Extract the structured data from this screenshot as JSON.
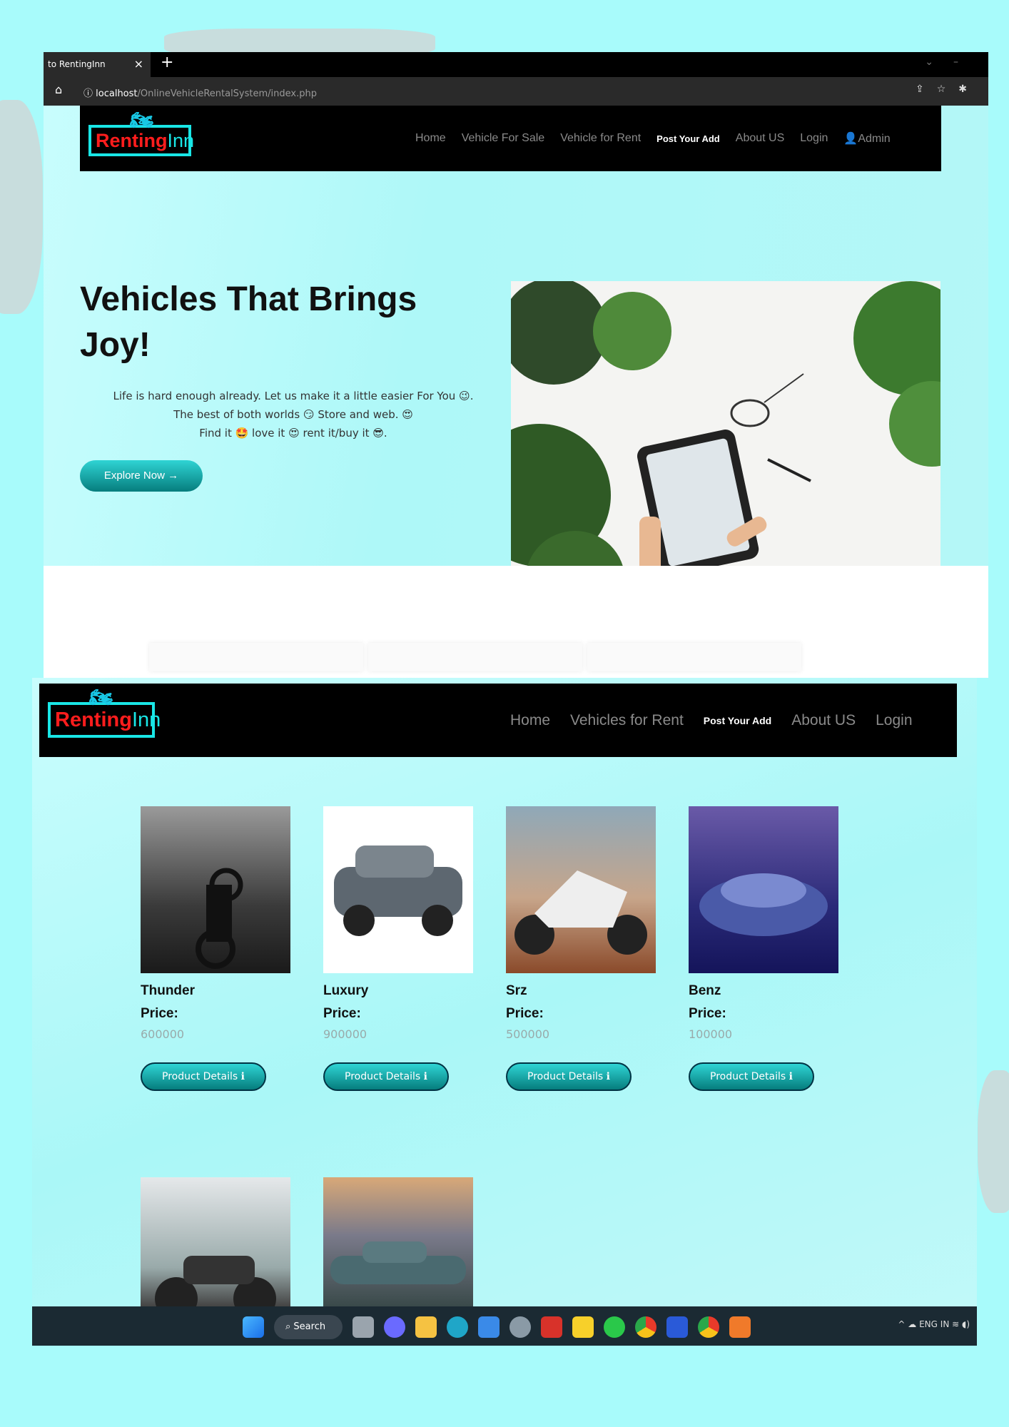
{
  "browser": {
    "tab_title": "to RentingInn",
    "tab_close": "×",
    "new_tab": "+",
    "url_host": "localhost",
    "url_path": "/OnlineVehicleRentalSystem/index.php"
  },
  "logo": {
    "part1": "Renting",
    "part2": "Inn"
  },
  "nav_top": {
    "items": [
      "Home",
      "Vehicle For Sale",
      "Vehicle for Rent",
      "Post Your Add",
      "About US",
      "Login"
    ],
    "admin": "Admin"
  },
  "hero": {
    "title": "Vehicles That Brings Joy!",
    "line1": "Life is hard enough already. Let us make it a little easier For You 😉.",
    "line2": "The best of both worlds 😏 Store and web. 😍",
    "line3": "Find it 🤩 love it 😍 rent it/buy it 😎.",
    "cta": "Explore Now →"
  },
  "nav_bottom": {
    "items": [
      "Home",
      "Vehicles for Rent",
      "Post Your Add",
      "About US",
      "Login"
    ]
  },
  "vehicles": [
    {
      "name": "Thunder",
      "price_label": "Price:",
      "price": "600000",
      "button": "Product Details ℹ"
    },
    {
      "name": "Luxury",
      "price_label": "Price:",
      "price": "900000",
      "button": "Product Details ℹ"
    },
    {
      "name": "Srz",
      "price_label": "Price:",
      "price": "500000",
      "button": "Product Details ℹ"
    },
    {
      "name": "Benz",
      "price_label": "Price:",
      "price": "100000",
      "button": "Product Details ℹ"
    }
  ],
  "taskbar": {
    "search": "Search",
    "lang": "ENG",
    "region": "IN"
  },
  "colors": {
    "page_bg": "#a8fbfb",
    "accent": "#19e6e6",
    "logo_red": "#ff1d1d",
    "button_top": "#2fd4d4",
    "button_bottom": "#067d7d"
  }
}
